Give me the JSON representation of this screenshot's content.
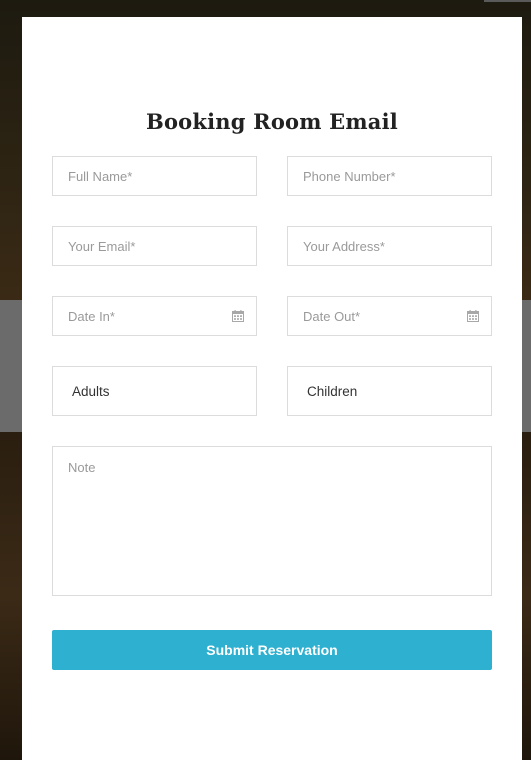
{
  "form": {
    "title": "Booking Room Email",
    "full_name_placeholder": "Full Name*",
    "phone_placeholder": "Phone Number*",
    "email_placeholder": "Your Email*",
    "address_placeholder": "Your Address*",
    "date_in_placeholder": "Date In*",
    "date_out_placeholder": "Date Out*",
    "adults_value": "Adults",
    "children_value": "Children",
    "note_placeholder": "Note",
    "submit_label": "Submit Reservation"
  },
  "icons": {
    "calendar": "calendar-icon"
  },
  "colors": {
    "accent": "#2eb0d0",
    "border": "#dcdcdc",
    "placeholder": "#9a9a9a"
  }
}
